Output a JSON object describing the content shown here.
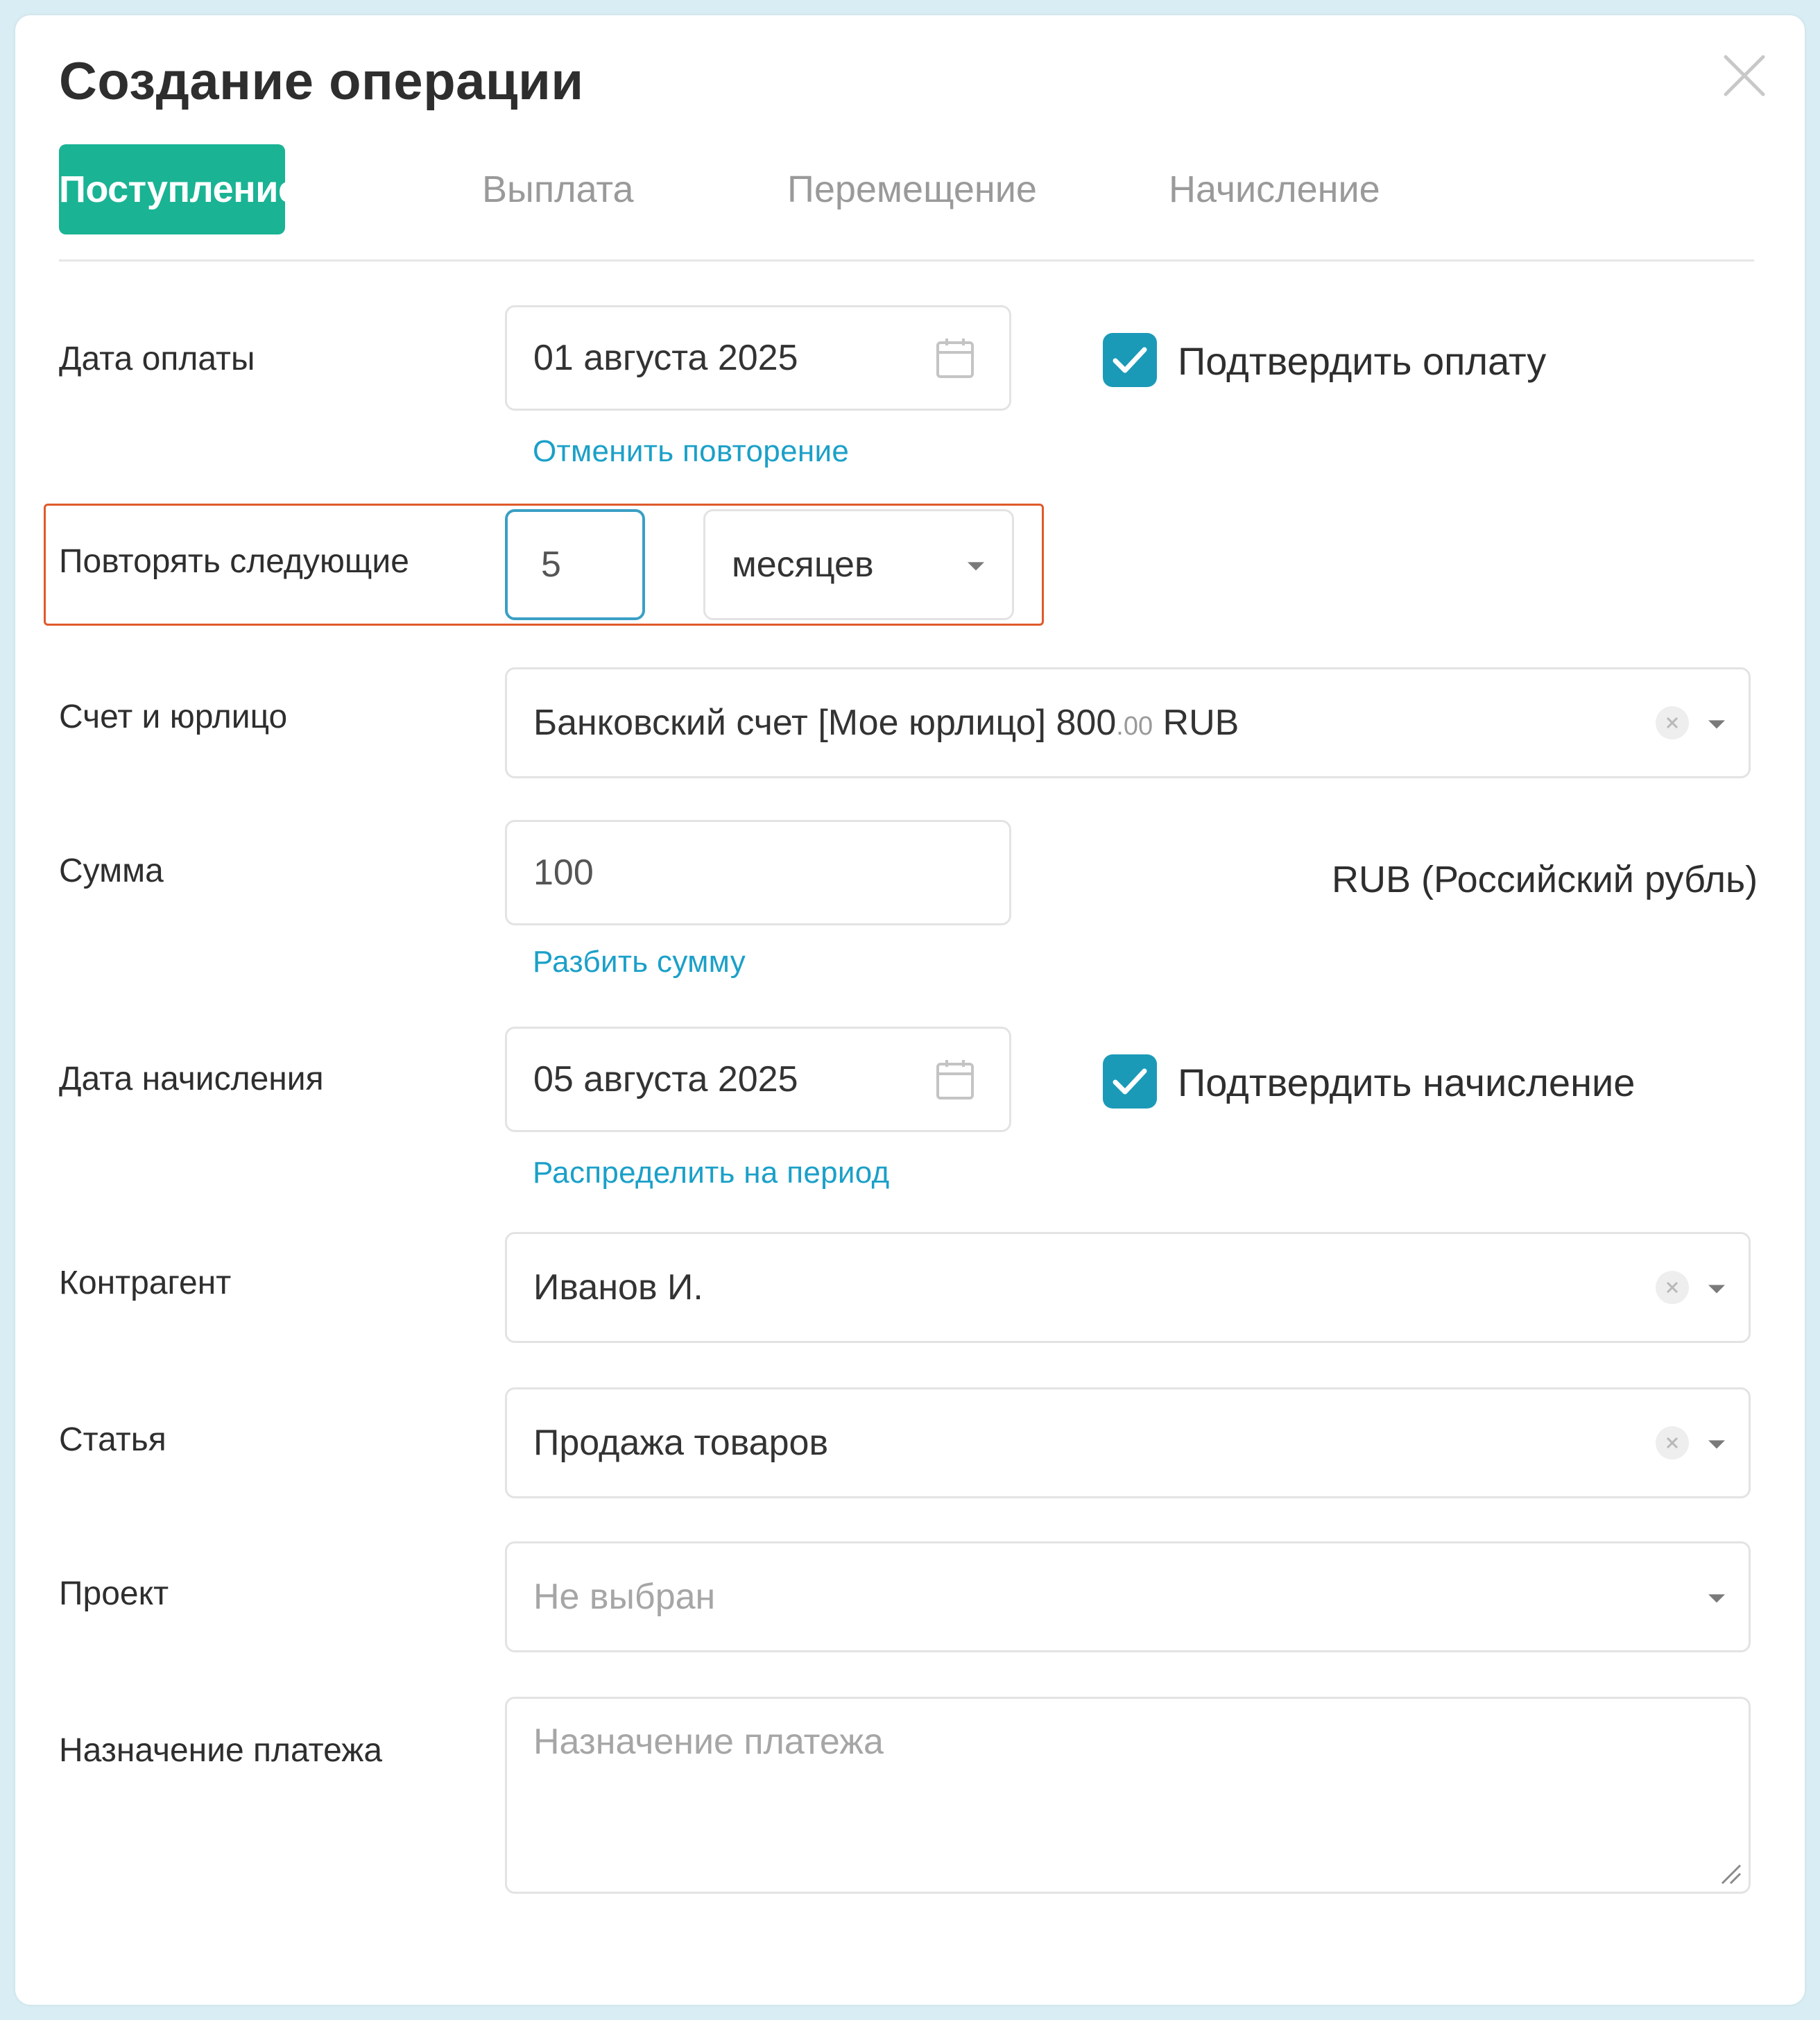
{
  "dialog": {
    "title": "Создание операции"
  },
  "tabs": [
    {
      "label": "Поступление",
      "active": true
    },
    {
      "label": "Выплата",
      "active": false
    },
    {
      "label": "Перемещение",
      "active": false
    },
    {
      "label": "Начисление",
      "active": false
    }
  ],
  "payment_date": {
    "label": "Дата оплаты",
    "value": "01 августа 2025",
    "cancel_repeat_link": "Отменить повторение",
    "confirm_label": "Подтвердить оплату",
    "confirmed": true
  },
  "repeat": {
    "label": "Повторять следующие",
    "count": "5",
    "unit": "месяцев"
  },
  "account": {
    "label": "Счет и юрлицо",
    "value_main": "Банковский счет [Мое юрлицо] 800",
    "value_cents": ".00",
    "value_currency": " RUB"
  },
  "amount": {
    "label": "Сумма",
    "value": "100",
    "split_link": "Разбить сумму",
    "currency": "RUB (Российский рубль)"
  },
  "accrual_date": {
    "label": "Дата начисления",
    "value": "05 августа 2025",
    "distribute_link": "Распределить на период",
    "confirm_label": "Подтвердить начисление",
    "confirmed": true
  },
  "counterparty": {
    "label": "Контрагент",
    "value": "Иванов И."
  },
  "article": {
    "label": "Статья",
    "value": "Продажа товаров"
  },
  "project": {
    "label": "Проект",
    "placeholder": "Не выбран"
  },
  "purpose": {
    "label": "Назначение платежа",
    "placeholder": "Назначение платежа"
  },
  "colors": {
    "accent_green": "#1ab394",
    "checkbox_blue": "#1b9ab8",
    "link_blue": "#1ba0c8",
    "highlight_border": "#e05a2b"
  },
  "icons": {
    "close": "close-icon",
    "calendar": "calendar-icon",
    "check": "check-icon",
    "clear": "clear-icon",
    "dropdown": "chevron-down-icon"
  }
}
